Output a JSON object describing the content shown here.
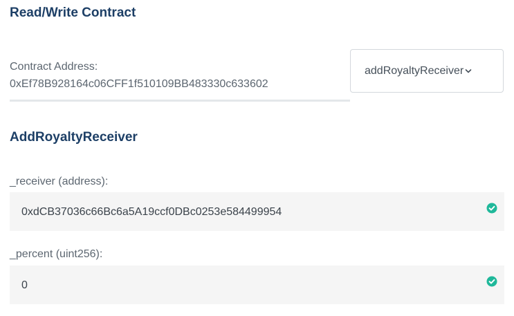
{
  "header": {
    "title": "Read/Write Contract"
  },
  "contract": {
    "address_label": "Contract Address:",
    "address": "0xEf78B928164c06CFF1f510109BB483330c633602"
  },
  "method_select": {
    "selected": "addRoyaltyReceiver"
  },
  "function": {
    "title": "AddRoyaltyReceiver",
    "params": [
      {
        "label": "_receiver (address):",
        "value": "0xdCB37036c66Bc6a5A19ccf0DBc0253e584499954",
        "valid": true
      },
      {
        "label": "_percent (uint256):",
        "value": "0",
        "valid": true
      }
    ]
  },
  "colors": {
    "heading": "#1d3f66",
    "valid_check": "#1fb89a",
    "field_bg": "#f5f5f5"
  },
  "icons": {
    "dropdown": "chevron-down-icon",
    "valid": "check-circle-icon"
  }
}
